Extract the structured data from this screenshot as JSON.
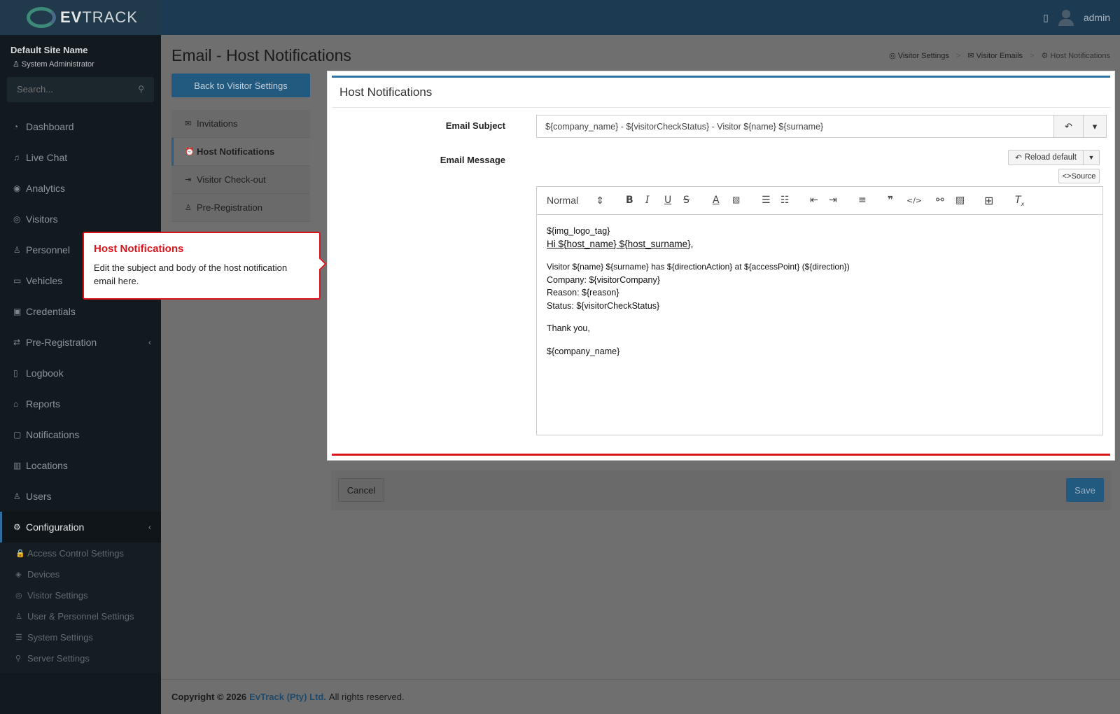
{
  "app": {
    "brand_prefix": "EV",
    "brand_suffix": "TRACK"
  },
  "topbar": {
    "book_icon": "book-icon",
    "user_name": "admin"
  },
  "sidebar": {
    "site_name": "Default Site Name",
    "role": "System Administrator",
    "search_placeholder": "Search...",
    "items": [
      {
        "label": "Dashboard",
        "icon": "dashboard-icon",
        "glyph": "◔"
      },
      {
        "label": "Live Chat",
        "icon": "headset-icon",
        "glyph": "♫"
      },
      {
        "label": "Analytics",
        "icon": "analytics-icon",
        "glyph": "◉"
      },
      {
        "label": "Visitors",
        "icon": "eye-icon",
        "glyph": "◎"
      },
      {
        "label": "Personnel",
        "icon": "users-icon",
        "glyph": "♙"
      },
      {
        "label": "Vehicles",
        "icon": "car-icon",
        "glyph": "▭"
      },
      {
        "label": "Credentials",
        "icon": "id-card-icon",
        "glyph": "▣"
      },
      {
        "label": "Pre-Registration",
        "icon": "arrows-icon",
        "glyph": "⇄",
        "chevron": "‹"
      },
      {
        "label": "Logbook",
        "icon": "book-icon",
        "glyph": "▯"
      },
      {
        "label": "Reports",
        "icon": "reports-icon",
        "glyph": "⌂"
      },
      {
        "label": "Notifications",
        "icon": "message-icon",
        "glyph": "▢"
      },
      {
        "label": "Locations",
        "icon": "building-icon",
        "glyph": "▥"
      },
      {
        "label": "Users",
        "icon": "user-icon",
        "glyph": "♙"
      },
      {
        "label": "Configuration",
        "icon": "gear-icon",
        "glyph": "⚙",
        "chevron": "‹"
      }
    ],
    "sub_items": [
      {
        "label": "Access Control Settings",
        "icon": "lock-icon",
        "glyph": "🔒"
      },
      {
        "label": "Devices",
        "icon": "device-icon",
        "glyph": "◈"
      },
      {
        "label": "Visitor Settings",
        "icon": "eye-icon",
        "glyph": "◎"
      },
      {
        "label": "User & Personnel Settings",
        "icon": "user-cog-icon",
        "glyph": "♙"
      },
      {
        "label": "System Settings",
        "icon": "sliders-icon",
        "glyph": "☰"
      },
      {
        "label": "Server Settings",
        "icon": "server-icon",
        "glyph": "⚲"
      }
    ]
  },
  "page": {
    "title": "Email - Host Notifications",
    "breadcrumbs": [
      "Visitor Settings",
      "Visitor Emails",
      "Host Notifications"
    ],
    "breadcrumb_sep": ">",
    "back_button": "Back to Visitor Settings",
    "subnav": [
      {
        "label": "Invitations",
        "icon": "envelope-icon",
        "glyph": "✉"
      },
      {
        "label": "Host Notifications",
        "icon": "bell-icon",
        "glyph": "⏰"
      },
      {
        "label": "Visitor Check-out",
        "icon": "sign-out-icon",
        "glyph": "⇥"
      },
      {
        "label": "Pre-Registration",
        "icon": "user-check-icon",
        "glyph": "♙"
      }
    ]
  },
  "tooltip": {
    "title": "Host Notifications",
    "body": "Edit the subject and body of the host notification email here."
  },
  "panel": {
    "title": "Host Notifications",
    "subject_label": "Email Subject",
    "subject_value": "${company_name} - ${visitorCheckStatus} - Visitor ${name} ${surname}",
    "message_label": "Email Message",
    "reload_label": "Reload default",
    "source_label": "Source",
    "format_select": "Normal",
    "body_lines": [
      "${img_logo_tag}",
      "Hi ${host_name} ${host_surname},",
      "Visitor ${name} ${surname} has ${directionAction} at ${accessPoint} (${direction})",
      "Company: ${visitorCompany}",
      "Reason: ${reason}",
      "Status: ${visitorCheckStatus}",
      "Thank you,",
      "${company_name}"
    ],
    "cancel_label": "Cancel",
    "save_label": "Save"
  },
  "footer": {
    "copyright": "Copyright © 2026",
    "company": "EvTrack (Pty) Ltd.",
    "rights": "All rights reserved."
  },
  "colors": {
    "primary": "#21597f",
    "accent_red": "#d9151c",
    "sidebar_bg": "#121a20",
    "topbar_bg": "#1c3b52"
  }
}
